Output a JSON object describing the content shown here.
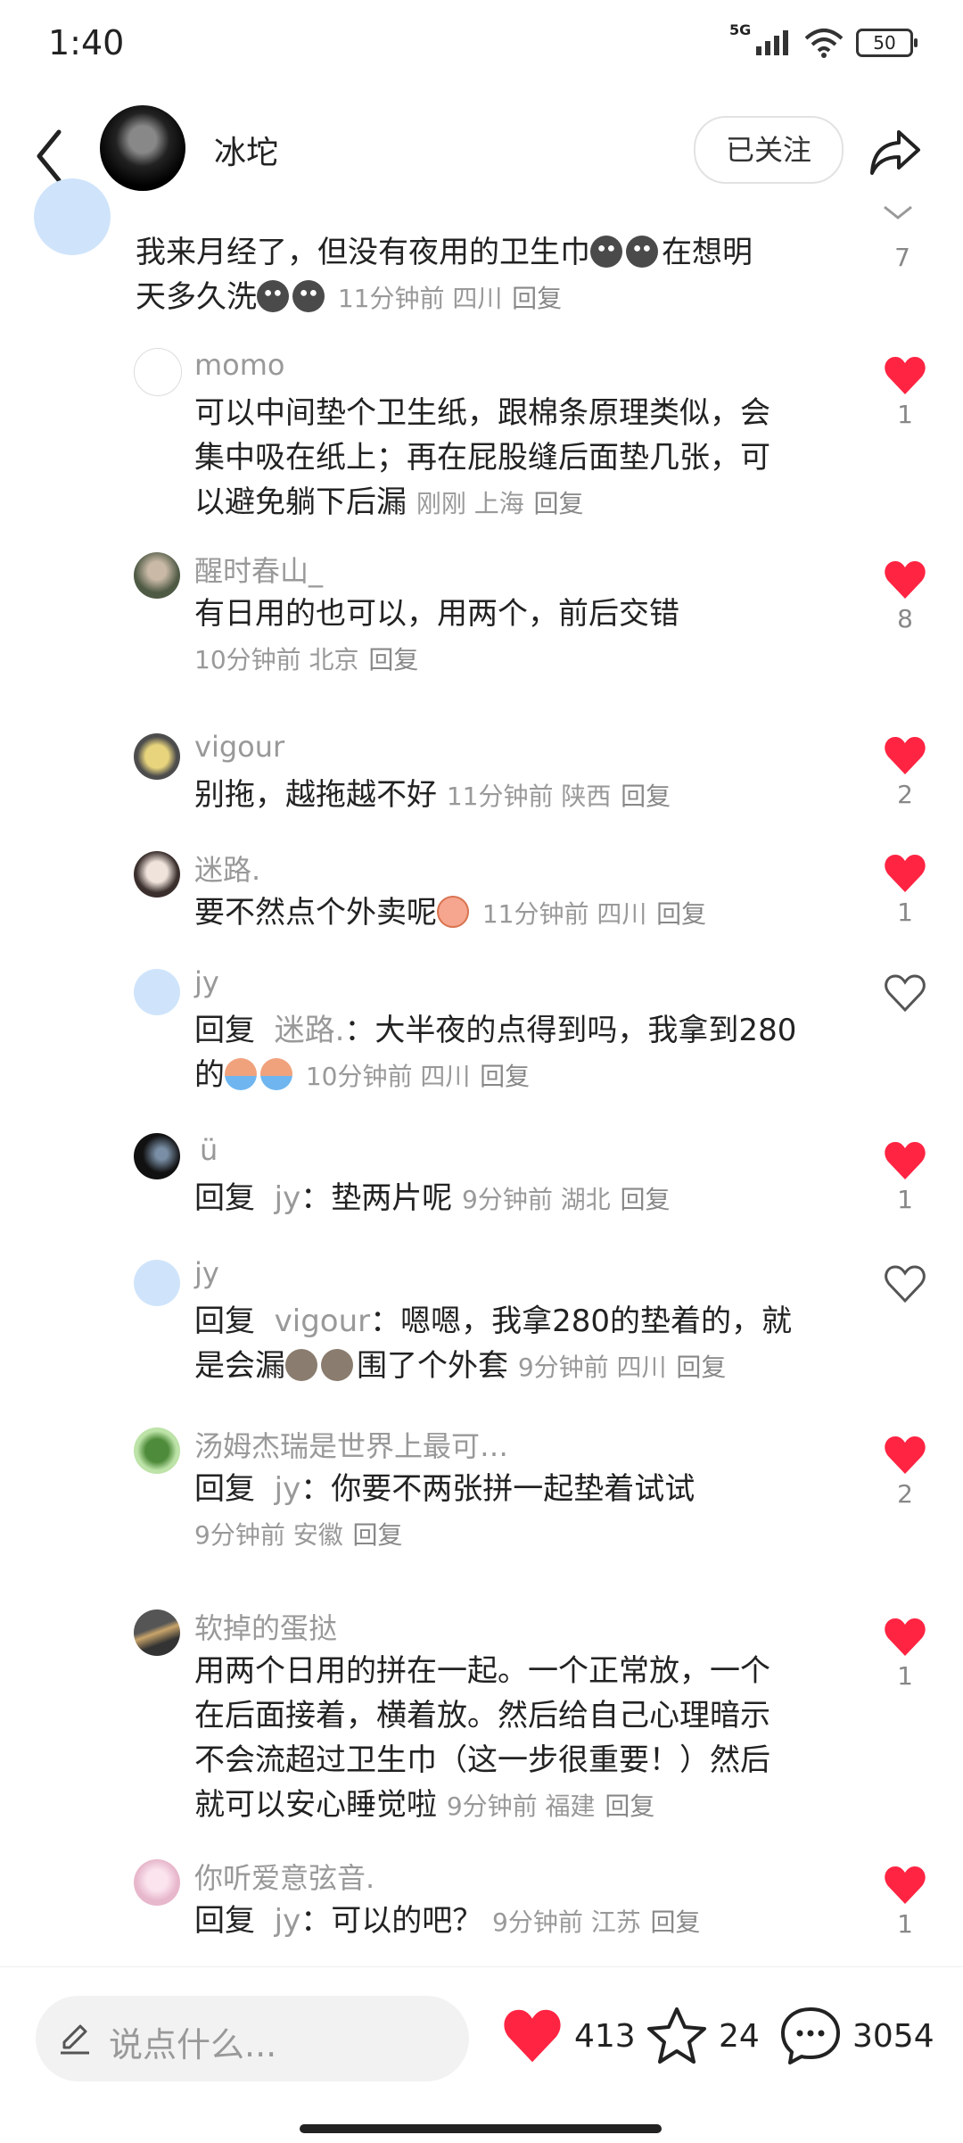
{
  "status": {
    "time": "1:40",
    "network": "5G",
    "battery": "50"
  },
  "header": {
    "name": "冰坨",
    "follow": "已关注"
  },
  "top_comment": {
    "line1": "我来月经了，但没有夜用的卫生巾",
    "line1b": "在想明",
    "line2": "天多久洗",
    "meta": "11分钟前 四川",
    "reply": "回复",
    "like_count": "7"
  },
  "replies": [
    {
      "user": "momo",
      "lines": [
        "可以中间垫个卫生纸，跟棉条原理类似，会",
        "集中吸在纸上；再在屁股缝后面垫几张，可",
        "以避免躺下后漏"
      ],
      "meta": "刚刚 上海",
      "reply": "回复",
      "likes": "1",
      "liked": true
    },
    {
      "user": "醒时春山_",
      "lines": [
        "有日用的也可以，用两个，前后交错"
      ],
      "meta": "10分钟前 北京",
      "reply": "回复",
      "likes": "8",
      "liked": true
    },
    {
      "user": "vigour",
      "lines": [
        "别拖，越拖越不好"
      ],
      "meta": "11分钟前 陕西",
      "reply": "回复",
      "likes": "2",
      "liked": true
    },
    {
      "user": "迷路.",
      "lines": [
        "要不然点个外卖呢"
      ],
      "meta": "11分钟前 四川",
      "reply": "回复",
      "likes": "1",
      "liked": true
    },
    {
      "user": "jy",
      "prefix": "回复",
      "target": "迷路.",
      "lines": [
        "：大半夜的点得到吗，我拿到280",
        "的"
      ],
      "meta": "10分钟前 四川",
      "reply": "回复",
      "likes": "",
      "liked": false
    },
    {
      "user": "ü",
      "prefix": "回复",
      "target": "jy",
      "lines": [
        "：垫两片呢"
      ],
      "meta": "9分钟前 湖北",
      "reply": "回复",
      "likes": "1",
      "liked": true
    },
    {
      "user": "jy",
      "prefix": "回复",
      "target": "vigour",
      "lines": [
        "：嗯嗯，我拿280的垫着的，就",
        "是会漏",
        "围了个外套"
      ],
      "meta": "9分钟前 四川",
      "reply": "回复",
      "likes": "",
      "liked": false
    },
    {
      "user": "汤姆杰瑞是世界上最可…",
      "prefix": "回复",
      "target": "jy",
      "lines": [
        "：你要不两张拼一起垫着试试"
      ],
      "meta": "9分钟前 安徽",
      "reply": "回复",
      "likes": "2",
      "liked": true
    },
    {
      "user": "软掉的蛋挞",
      "lines": [
        "用两个日用的拼在一起。一个正常放，一个",
        "在后面接着，横着放。然后给自己心理暗示",
        "不会流超过卫生巾（这一步很重要！）然后",
        "就可以安心睡觉啦"
      ],
      "meta": "9分钟前 福建",
      "reply": "回复",
      "likes": "1",
      "liked": true
    },
    {
      "user": "你听爱意弦音.",
      "prefix": "回复",
      "target": "jy",
      "lines": [
        "：可以的吧？"
      ],
      "meta": "9分钟前 江苏",
      "reply": "回复",
      "likes": "1",
      "liked": true
    }
  ],
  "bottom": {
    "placeholder": "说点什么...",
    "likes": "413",
    "favorites": "24",
    "comments": "3054"
  },
  "colors": {
    "like_red": "#ff2442",
    "text": "#222222",
    "muted": "#999999"
  }
}
